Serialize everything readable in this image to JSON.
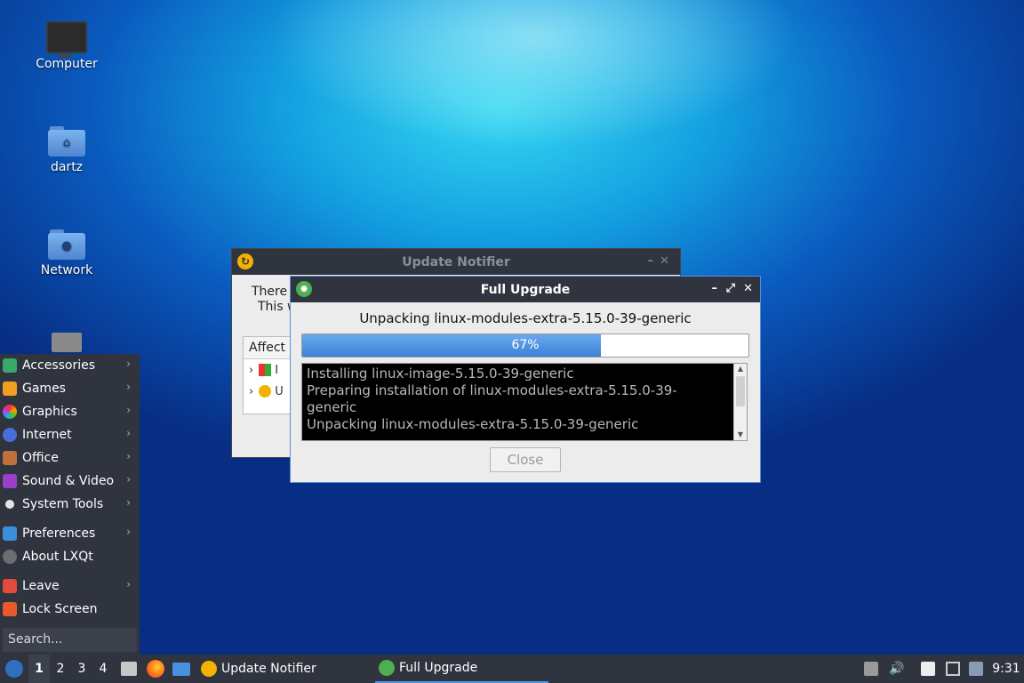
{
  "desktop": {
    "icons": [
      {
        "label": "Computer",
        "icon": "computer-icon"
      },
      {
        "label": "dartz",
        "icon": "home-folder-icon"
      },
      {
        "label": "Network",
        "icon": "network-folder-icon"
      },
      {
        "label": "",
        "icon": "trash-icon"
      }
    ]
  },
  "start_menu": {
    "items": [
      {
        "label": "Accessories",
        "has_submenu": true
      },
      {
        "label": "Games",
        "has_submenu": true
      },
      {
        "label": "Graphics",
        "has_submenu": true
      },
      {
        "label": "Internet",
        "has_submenu": true
      },
      {
        "label": "Office",
        "has_submenu": true
      },
      {
        "label": "Sound & Video",
        "has_submenu": true
      },
      {
        "label": "System Tools",
        "has_submenu": true
      },
      {
        "label": "Preferences",
        "has_submenu": true
      },
      {
        "label": "About LXQt",
        "has_submenu": false
      },
      {
        "label": "Leave",
        "has_submenu": true
      },
      {
        "label": "Lock Screen",
        "has_submenu": false
      }
    ],
    "search_placeholder": "Search..."
  },
  "update_notifier": {
    "title": "Update Notifier",
    "text_line1": "There",
    "text_line2": "This w",
    "tree_header": "Affect",
    "tree_rows": [
      "I",
      "U"
    ]
  },
  "full_upgrade": {
    "title": "Full Upgrade",
    "status": "Unpacking linux-modules-extra-5.15.0-39-generic",
    "progress_label": "67%",
    "progress_fraction": 0.67,
    "log_lines": [
      "Installing linux-image-5.15.0-39-generic",
      "Preparing installation of linux-modules-extra-5.15.0-39-",
      "generic",
      "Unpacking linux-modules-extra-5.15.0-39-generic"
    ],
    "close_label": "Close"
  },
  "taskbar": {
    "workspaces": [
      "1",
      "2",
      "3",
      "4"
    ],
    "active_workspace": "1",
    "tasks": [
      {
        "label": "Update Notifier"
      },
      {
        "label": "Full Upgrade"
      }
    ],
    "clock": "9:31"
  },
  "colors": {
    "panel": "#2f343f",
    "accent": "#5294e2",
    "progress": "#3b82d6"
  }
}
